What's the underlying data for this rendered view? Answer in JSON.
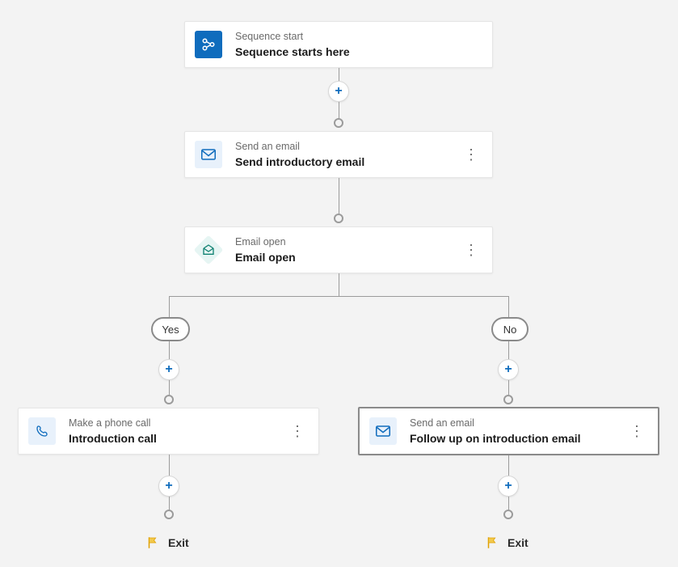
{
  "nodes": {
    "start": {
      "type_label": "Sequence start",
      "title": "Sequence starts here"
    },
    "email1": {
      "type_label": "Send an email",
      "title": "Send introductory email"
    },
    "cond": {
      "type_label": "Email open",
      "title": "Email open"
    },
    "call": {
      "type_label": "Make a phone call",
      "title": "Introduction call"
    },
    "email2": {
      "type_label": "Send an email",
      "title": "Follow up on introduction email"
    }
  },
  "branches": {
    "yes_label": "Yes",
    "no_label": "No"
  },
  "exit_label": "Exit",
  "plus_glyph": "+"
}
